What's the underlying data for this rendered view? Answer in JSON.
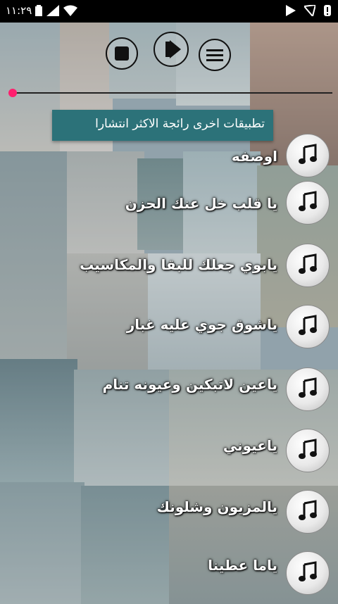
{
  "status_bar": {
    "time": "١١:٢٩"
  },
  "player": {
    "stop_icon": "stop-icon",
    "play_icon": "play-icon",
    "menu_icon": "menu-icon",
    "progress": 0.0
  },
  "banner": {
    "text": "تطبيقات اخرى رائجة الاكثر انتشارا"
  },
  "songs": [
    {
      "title": "اوصفه"
    },
    {
      "title": "يا قلب خل عنك الحزن"
    },
    {
      "title": "يابوي جعلك للبقا والمكاسيب"
    },
    {
      "title": "ياشوق جوي عليه غبار"
    },
    {
      "title": "ياعين لاتبكين وعيونه تنام"
    },
    {
      "title": "ياعيوني"
    },
    {
      "title": "يالمزيون وشلونك"
    },
    {
      "title": "ياما عطينا"
    }
  ],
  "colors": {
    "banner_bg": "#2c7279",
    "seek_thumb": "#ff1f6e",
    "status_bar": "#000000"
  }
}
